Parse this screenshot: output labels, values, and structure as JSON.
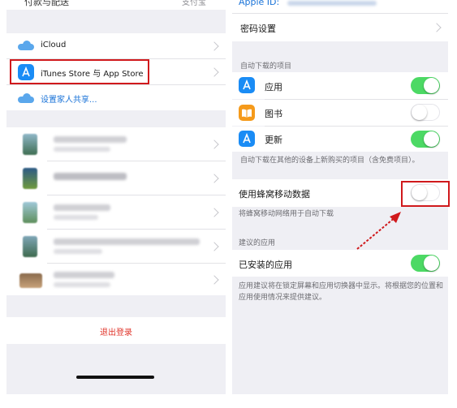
{
  "left": {
    "top_partial_label": "付款与配送",
    "top_partial_value": "支付宝",
    "icloud_label": "iCloud",
    "itunes_label": "iTunes Store 与 App Store",
    "family_label": "设置家人共享...",
    "devices": [
      {
        "name": "·"
      },
      {
        "name": "·"
      },
      {
        "name": "·"
      },
      {
        "name": "·"
      },
      {
        "name": "·"
      }
    ],
    "logout_label": "退出登录"
  },
  "right": {
    "top_partial_label": "Apple ID:",
    "password_label": "密码设置",
    "auto_download_header": "自动下载的项目",
    "apps_label": "应用",
    "books_label": "图书",
    "updates_label": "更新",
    "auto_download_footer": "自动下载在其他的设备上新购买的项目（含免费项目）。",
    "cellular_label": "使用蜂窝移动数据",
    "cellular_footer": "将蜂窝移动网络用于自动下载",
    "suggested_header": "建议的应用",
    "installed_label": "已安装的应用",
    "suggested_footer": "应用建议将在锁定屏幕和应用切换器中显示。将根据您的位置和应用使用情况来提供建议。",
    "toggles": {
      "apps": true,
      "books": false,
      "updates": true,
      "cellular": false,
      "installed": true
    }
  },
  "colors": {
    "toggle_on": "#4cd964",
    "highlight_red": "#d0191c",
    "logout_red": "#e0352b",
    "app_store_blue": "#1a8cf5",
    "books_orange": "#f59a1b"
  }
}
